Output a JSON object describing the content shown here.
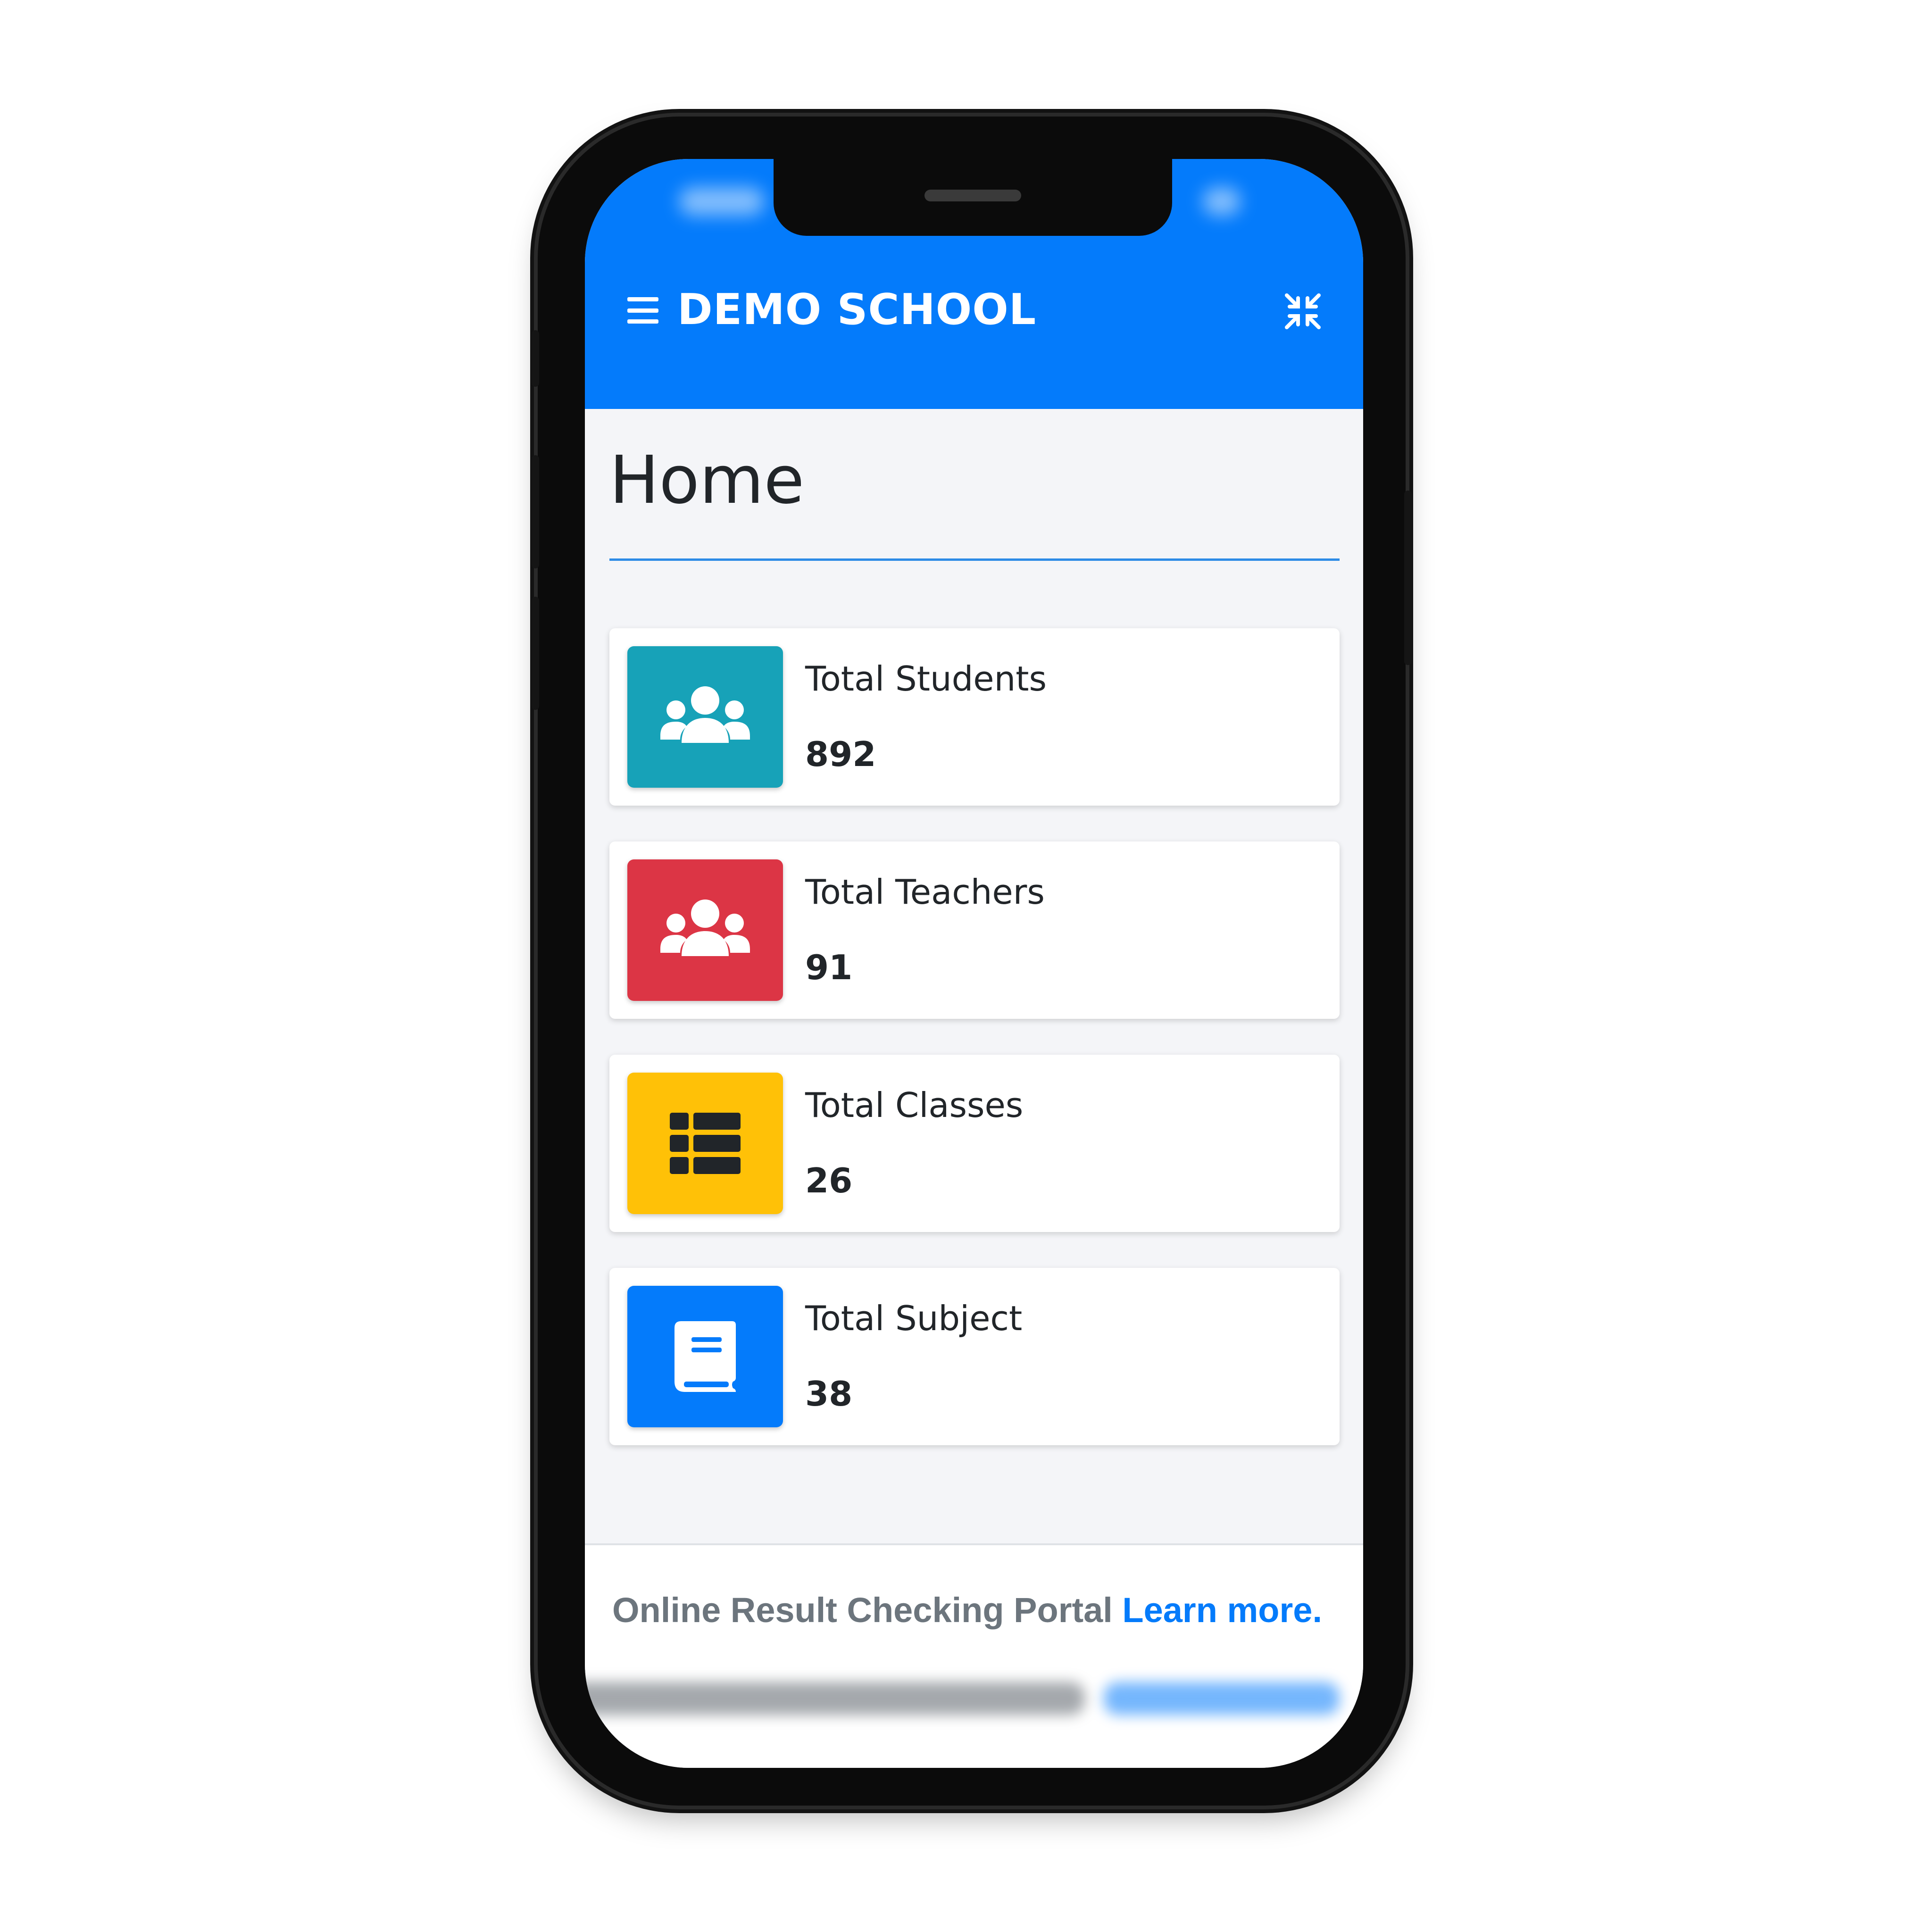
{
  "app": {
    "brand": "DEMO SCHOOL",
    "accent_color": "#047bfb"
  },
  "page": {
    "title": "Home"
  },
  "stats": [
    {
      "label": "Total Students",
      "value": "892",
      "color": "#17a2b8",
      "icon": "users-icon"
    },
    {
      "label": "Total Teachers",
      "value": "91",
      "color": "#dc3545",
      "icon": "users-icon"
    },
    {
      "label": "Total Classes",
      "value": "26",
      "color": "#ffc107",
      "icon": "list-icon"
    },
    {
      "label": "Total Subject",
      "value": "38",
      "color": "#047bfb",
      "icon": "book-icon"
    }
  ],
  "footer": {
    "text": "Online Result Checking Portal ",
    "link_label": "Learn more",
    "trailing": "."
  }
}
